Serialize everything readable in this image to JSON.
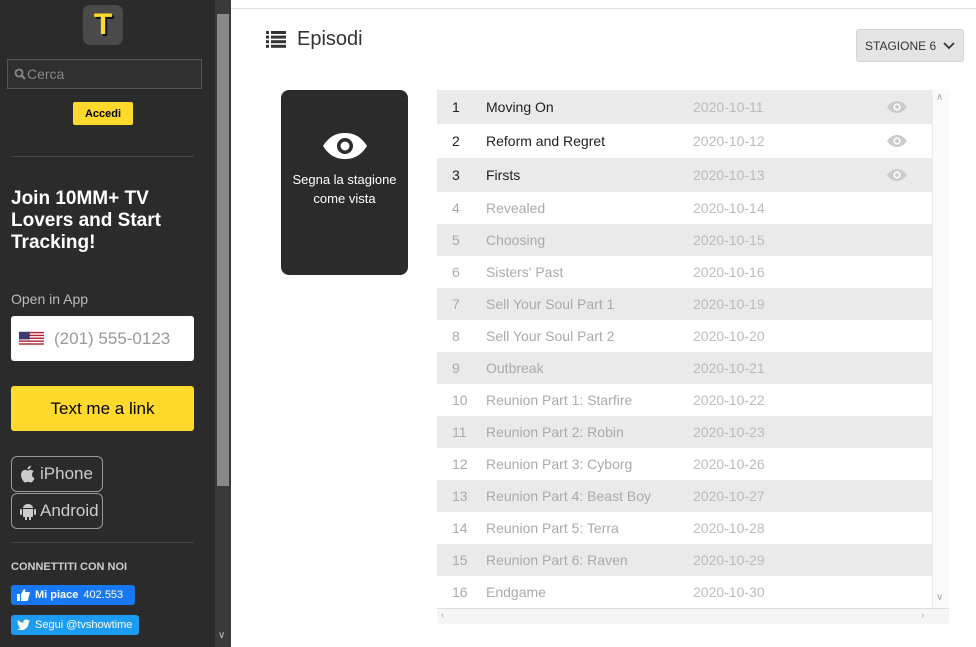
{
  "sidebar": {
    "logo_letter": "T",
    "search_placeholder": "Cerca",
    "login_label": "Accedi",
    "promo": "Join 10MM+ TV Lovers and Start Tracking!",
    "open_in_app": "Open in App",
    "phone_placeholder": "(201) 555-0123",
    "text_link_label": "Text me a link",
    "iphone_label": "iPhone",
    "android_label": "Android",
    "connect_label": "CONNETTITI CON NOI",
    "fb_like_label": "Mi piace",
    "fb_like_count": "402.553",
    "twitter_label": "Segui @tvshowtime"
  },
  "main": {
    "title": "Episodi",
    "season_label": "STAGIONE 6",
    "mark_season_label": "Segna la stagione come vista",
    "episodes": [
      {
        "num": "1",
        "title": "Moving On",
        "date": "2020-10-11",
        "aired": true
      },
      {
        "num": "2",
        "title": "Reform and Regret",
        "date": "2020-10-12",
        "aired": true
      },
      {
        "num": "3",
        "title": "Firsts",
        "date": "2020-10-13",
        "aired": true
      },
      {
        "num": "4",
        "title": "Revealed",
        "date": "2020-10-14",
        "aired": false
      },
      {
        "num": "5",
        "title": "Choosing",
        "date": "2020-10-15",
        "aired": false
      },
      {
        "num": "6",
        "title": "Sisters' Past",
        "date": "2020-10-16",
        "aired": false
      },
      {
        "num": "7",
        "title": "Sell Your Soul Part 1",
        "date": "2020-10-19",
        "aired": false
      },
      {
        "num": "8",
        "title": "Sell Your Soul Part 2",
        "date": "2020-10-20",
        "aired": false
      },
      {
        "num": "9",
        "title": "Outbreak",
        "date": "2020-10-21",
        "aired": false
      },
      {
        "num": "10",
        "title": "Reunion Part 1: Starfire",
        "date": "2020-10-22",
        "aired": false
      },
      {
        "num": "11",
        "title": "Reunion Part 2: Robin",
        "date": "2020-10-23",
        "aired": false
      },
      {
        "num": "12",
        "title": "Reunion Part 3: Cyborg",
        "date": "2020-10-26",
        "aired": false
      },
      {
        "num": "13",
        "title": "Reunion Part 4: Beast Boy",
        "date": "2020-10-27",
        "aired": false
      },
      {
        "num": "14",
        "title": "Reunion Part 5: Terra",
        "date": "2020-10-28",
        "aired": false
      },
      {
        "num": "15",
        "title": "Reunion Part 6: Raven",
        "date": "2020-10-29",
        "aired": false
      },
      {
        "num": "16",
        "title": "Endgame",
        "date": "2020-10-30",
        "aired": false
      }
    ]
  },
  "colors": {
    "accent": "#ffd92c",
    "sidebar_bg": "#2b2b2b",
    "facebook": "#1877f2",
    "twitter": "#1d9bf0"
  },
  "icons": [
    "search-icon",
    "us-flag-icon",
    "apple-icon",
    "android-icon",
    "facebook-like-icon",
    "twitter-icon",
    "list-icon",
    "chevron-down-icon",
    "eye-icon"
  ]
}
